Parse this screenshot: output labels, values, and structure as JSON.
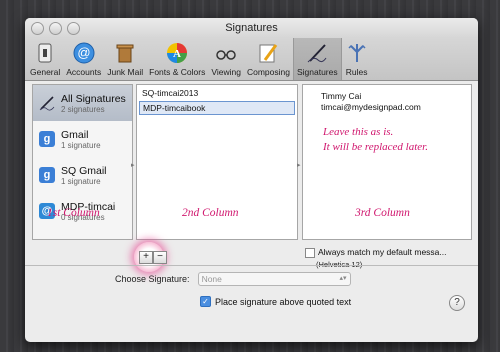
{
  "window": {
    "title": "Signatures"
  },
  "toolbar": {
    "items": [
      {
        "label": "General",
        "icon": "general-switch-icon"
      },
      {
        "label": "Accounts",
        "icon": "at-sign-icon"
      },
      {
        "label": "Junk Mail",
        "icon": "trash-bin-icon"
      },
      {
        "label": "Fonts & Colors",
        "icon": "color-palette-icon"
      },
      {
        "label": "Viewing",
        "icon": "glasses-icon"
      },
      {
        "label": "Composing",
        "icon": "pencil-note-icon"
      },
      {
        "label": "Signatures",
        "icon": "signature-pen-icon",
        "active": true
      },
      {
        "label": "Rules",
        "icon": "rules-arrows-icon"
      }
    ]
  },
  "accounts": [
    {
      "name": "All Signatures",
      "count": "2 signatures",
      "icon": "signature-pen-icon",
      "selected": true
    },
    {
      "name": "Gmail",
      "count": "1 signature",
      "icon": "google-g-icon",
      "color": "#3b7fd6"
    },
    {
      "name": "SQ Gmail",
      "count": "1 signature",
      "icon": "google-g-icon",
      "color": "#3b7fd6"
    },
    {
      "name": "MDP-timcai",
      "count": "0 signatures",
      "icon": "at-sign-icon",
      "color": "#2e89d6"
    }
  ],
  "signatures": [
    "SQ-timcai2013",
    "MDP-timcaibook"
  ],
  "preview": {
    "line1": "Timmy Cai",
    "line2": "timcai@mydesignpad.com"
  },
  "annotations": {
    "col1": "1st Column",
    "col2": "2nd Column",
    "col3": "3rd Column",
    "note1": "Leave this as is.",
    "note2": "It will be replaced later."
  },
  "controls": {
    "add": "+",
    "remove": "−",
    "always_match": "Always match my default messa...",
    "font": "(Helvetica 12)",
    "choose_label": "Choose Signature:",
    "choose_value": "None",
    "place_label": "Place signature above quoted text",
    "help": "?"
  },
  "colors": {
    "annotation": "#d0176e",
    "selection": "#6b95d0"
  }
}
